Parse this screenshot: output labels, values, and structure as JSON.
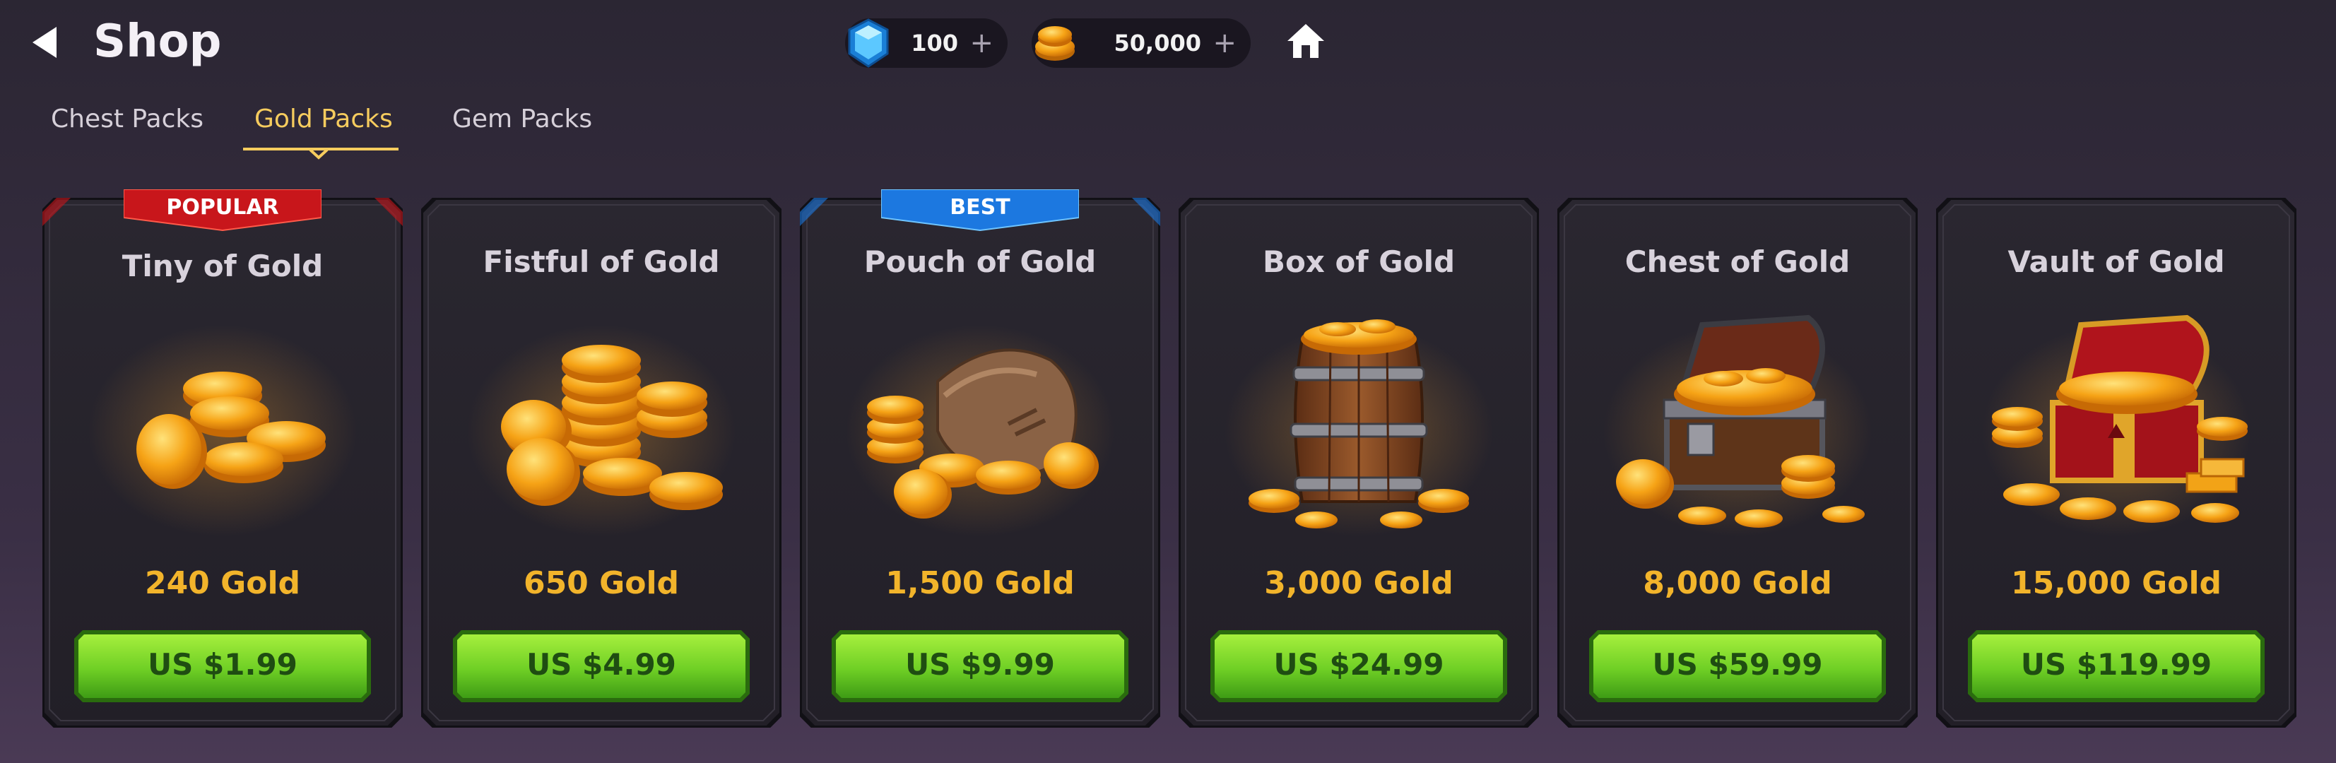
{
  "header": {
    "title": "Shop",
    "currencies": {
      "gems": {
        "value": "100",
        "icon": "gem-icon"
      },
      "gold": {
        "value": "50,000",
        "icon": "gold-coins-icon"
      }
    }
  },
  "tabs": [
    {
      "label": "Chest Packs",
      "active": false
    },
    {
      "label": "Gold Packs",
      "active": true
    },
    {
      "label": "Gem Packs",
      "active": false
    }
  ],
  "colors": {
    "accent": "#f6cc5e",
    "gold_text": "#f2b42b",
    "button_green": "#7fd22e",
    "popular_red": "#c8161b",
    "best_blue": "#1c78e0"
  },
  "packs": [
    {
      "name": "Tiny of Gold",
      "amount": "240 Gold",
      "price": "US $1.99",
      "badge": "POPULAR",
      "art": "small-coin-pile-icon"
    },
    {
      "name": "Fistful of Gold",
      "amount": "650 Gold",
      "price": "US $4.99",
      "badge": "",
      "art": "coin-stacks-icon"
    },
    {
      "name": "Pouch of Gold",
      "amount": "1,500 Gold",
      "price": "US $9.99",
      "badge": "BEST",
      "art": "coin-pouch-icon"
    },
    {
      "name": "Box of Gold",
      "amount": "3,000 Gold",
      "price": "US $24.99",
      "badge": "",
      "art": "gold-barrel-icon"
    },
    {
      "name": "Chest of Gold",
      "amount": "8,000 Gold",
      "price": "US $59.99",
      "badge": "",
      "art": "gold-chest-icon"
    },
    {
      "name": "Vault of Gold",
      "amount": "15,000 Gold",
      "price": "US $119.99",
      "badge": "",
      "art": "gold-vault-icon"
    }
  ]
}
